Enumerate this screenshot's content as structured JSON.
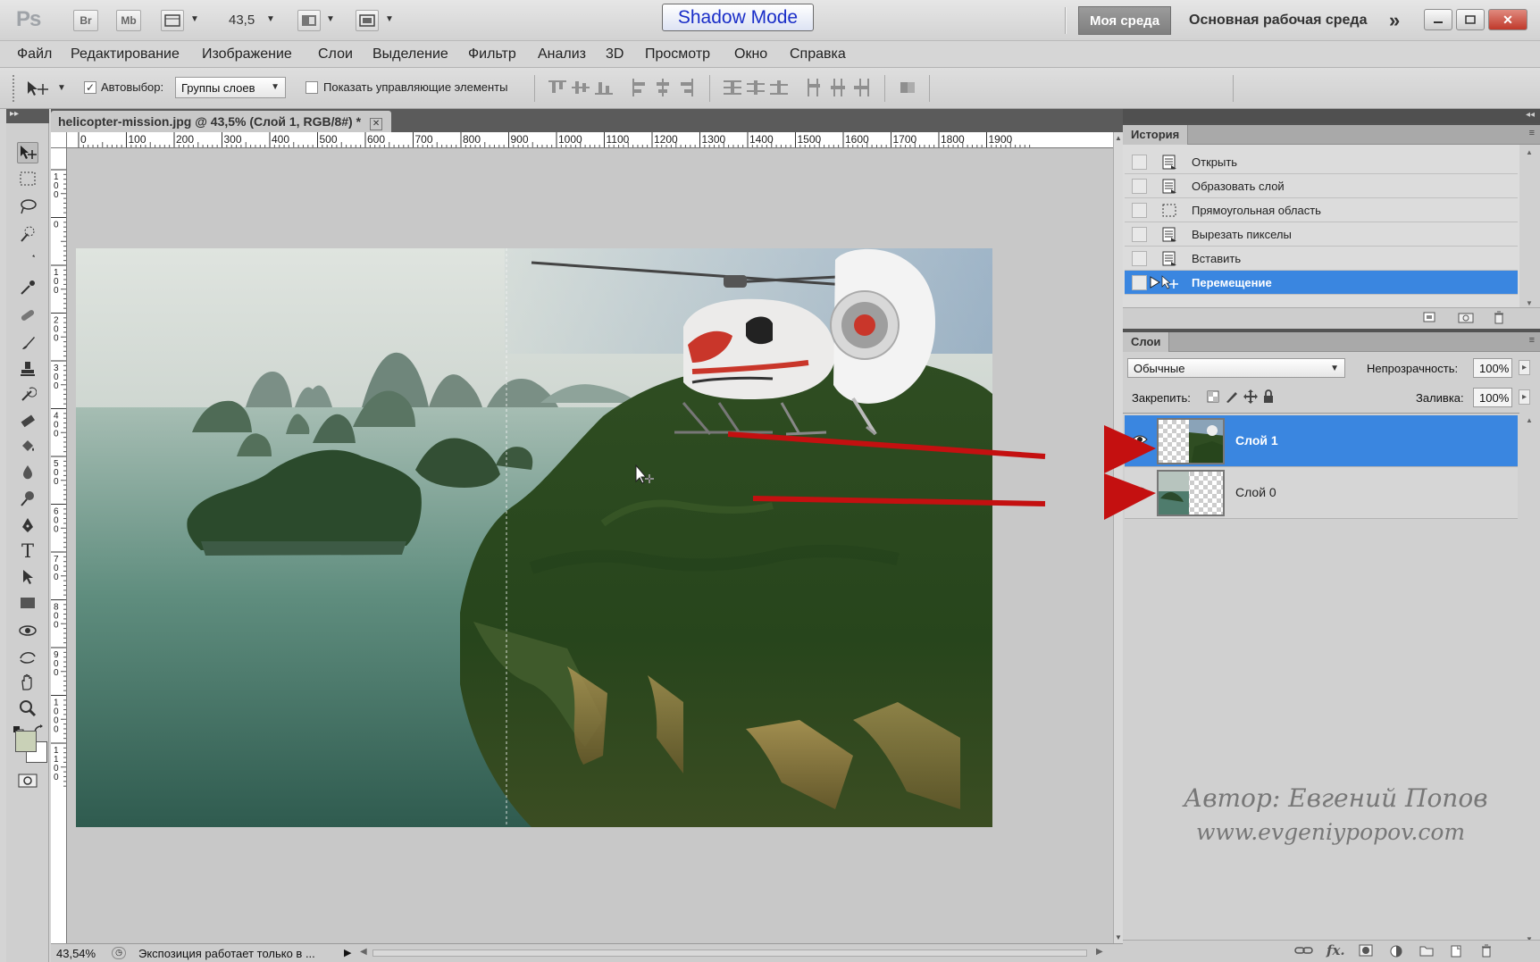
{
  "app": {
    "logo": "Ps",
    "quick_buttons": [
      "Br",
      "Mb"
    ],
    "zoom_value": "43,5",
    "shadow_mode": "Shadow Mode",
    "workspace_active": "Моя среда",
    "workspace_main": "Основная рабочая среда",
    "window_controls": [
      "minimize-icon",
      "restore-icon",
      "close-icon"
    ]
  },
  "menu": [
    "Файл",
    "Редактирование",
    "Изображение",
    "Слои",
    "Выделение",
    "Фильтр",
    "Анализ",
    "3D",
    "Просмотр",
    "Окно",
    "Справка"
  ],
  "options": {
    "autoselect_label": "Автовыбор:",
    "autoselect_checked": true,
    "autoselect_value": "Группы слоев",
    "show_controls_label": "Показать управляющие элементы",
    "show_controls_checked": false
  },
  "document": {
    "tab_title": "helicopter-mission.jpg @ 43,5% (Слой 1, RGB/8#) *",
    "ruler_h": [
      "0",
      "100",
      "200",
      "300",
      "400",
      "500",
      "600",
      "700",
      "800",
      "900",
      "1000",
      "1100",
      "1200",
      "1300",
      "1400",
      "1500",
      "1600",
      "1700",
      "1800",
      "1900"
    ],
    "ruler_v": [
      "1\n0\n0",
      "0",
      "1\n0\n0",
      "2\n0\n0",
      "3\n0\n0",
      "4\n0\n0",
      "5\n0\n0",
      "6\n0\n0",
      "7\n0\n0",
      "8\n0\n0",
      "9\n0\n0",
      "1\n0\n0\n0",
      "1\n1\n0\n0"
    ],
    "status_zoom": "43,54%",
    "status_message": "Экспозиция работает только в ..."
  },
  "history": {
    "tab": "История",
    "steps": [
      {
        "label": "Открыть",
        "icon": "document-icon"
      },
      {
        "label": "Образовать слой",
        "icon": "document-icon"
      },
      {
        "label": "Прямоугольная область",
        "icon": "marquee-icon"
      },
      {
        "label": "Вырезать пикселы",
        "icon": "document-icon"
      },
      {
        "label": "Вставить",
        "icon": "document-icon"
      },
      {
        "label": "Перемещение",
        "icon": "move-icon",
        "selected": true
      }
    ]
  },
  "layers": {
    "tab": "Слои",
    "blend_mode": "Обычные",
    "opacity_label": "Непрозрачность:",
    "opacity_value": "100%",
    "lock_label": "Закрепить:",
    "fill_label": "Заливка:",
    "fill_value": "100%",
    "items": [
      {
        "name": "Слой 1",
        "visible": true,
        "selected": true
      },
      {
        "name": "Слой 0",
        "visible": true,
        "selected": false
      }
    ]
  },
  "watermark": {
    "author": "Автор: Евгений Попов",
    "site": "www.evgeniypopov.com"
  },
  "colors": {
    "selection_blue": "#3a86e0",
    "arrow_red": "#c41010",
    "shadow_mode_text": "#1a2ec8"
  }
}
